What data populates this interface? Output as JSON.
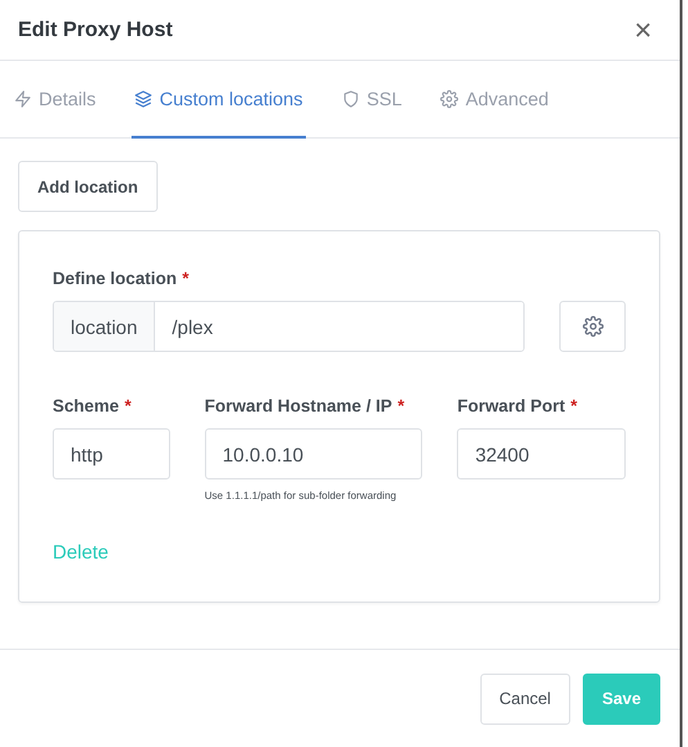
{
  "window": {
    "title": "Edit Proxy Host",
    "close": "×"
  },
  "tabs": [
    {
      "label": "Details",
      "selected": false
    },
    {
      "label": "Custom locations",
      "selected": true
    },
    {
      "label": "SSL",
      "selected": false
    },
    {
      "label": "Advanced",
      "selected": false
    }
  ],
  "add_button": "Add location",
  "location": {
    "label": "Define location",
    "required_mark": "*",
    "prefix": "location",
    "value": "/plex"
  },
  "fields": [
    {
      "label": "Scheme",
      "required_mark": "*",
      "value": "http"
    },
    {
      "label": "Forward Hostname / IP",
      "required_mark": "*",
      "value": "10.0.0.10",
      "help": "Use 1.1.1.1/path for sub-folder forwarding"
    },
    {
      "label": "Forward Port",
      "required_mark": "*",
      "value": "32400"
    }
  ],
  "delete_link": "Delete",
  "buttons": [
    {
      "label": "Cancel",
      "kind": "secondary"
    },
    {
      "label": "Save",
      "kind": "primary"
    }
  ]
}
